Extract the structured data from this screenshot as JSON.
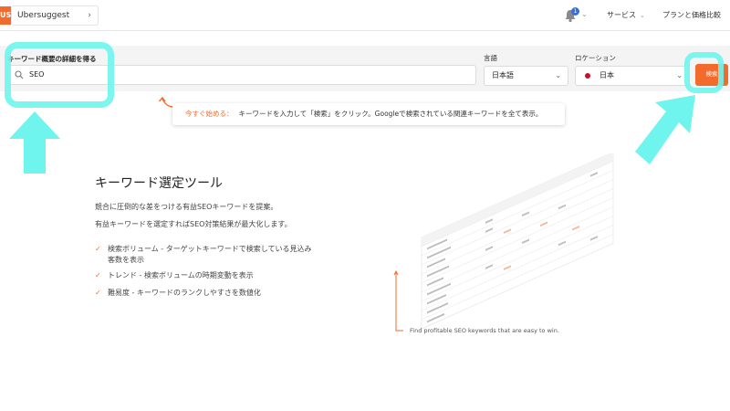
{
  "header": {
    "logo_text": "US",
    "project_name": "Ubersuggest",
    "notification_count": "1",
    "services_label": "サービス",
    "pricing_label": "プランと価格比較"
  },
  "search": {
    "keyword_label": "キーワード概要の詳細を得る",
    "keyword_value": "SEO",
    "language_label": "言語",
    "language_value": "日本語",
    "location_label": "ロケーション",
    "location_value": "日本",
    "search_button": "検索"
  },
  "tip": {
    "lead": "今すぐ始める：",
    "text": "キーワードを入力して「検索」をクリック。Googleで検索されている関連キーワードを全て表示。"
  },
  "hero": {
    "title": "キーワード選定ツール",
    "desc1": "競合に圧倒的な差をつける有益SEOキーワードを提案。",
    "desc2": "有益キーワードを選定すればSEO対策結果が最大化します。",
    "features": [
      {
        "line1": "検索ボリューム - ターゲットキーワードで検索している見込み",
        "line2": "客数を表示"
      },
      {
        "line1": "トレンド - 検索ボリュームの時期変動を表示",
        "line2": ""
      },
      {
        "line1": "難易度 - キーワードのランクしやすさを数値化",
        "line2": ""
      }
    ],
    "caption": "Find profitable SEO keywords that are easy to win."
  },
  "colors": {
    "accent": "#f36a2d",
    "annotation": "#6ff5ee",
    "badge": "#3b6fd6"
  }
}
